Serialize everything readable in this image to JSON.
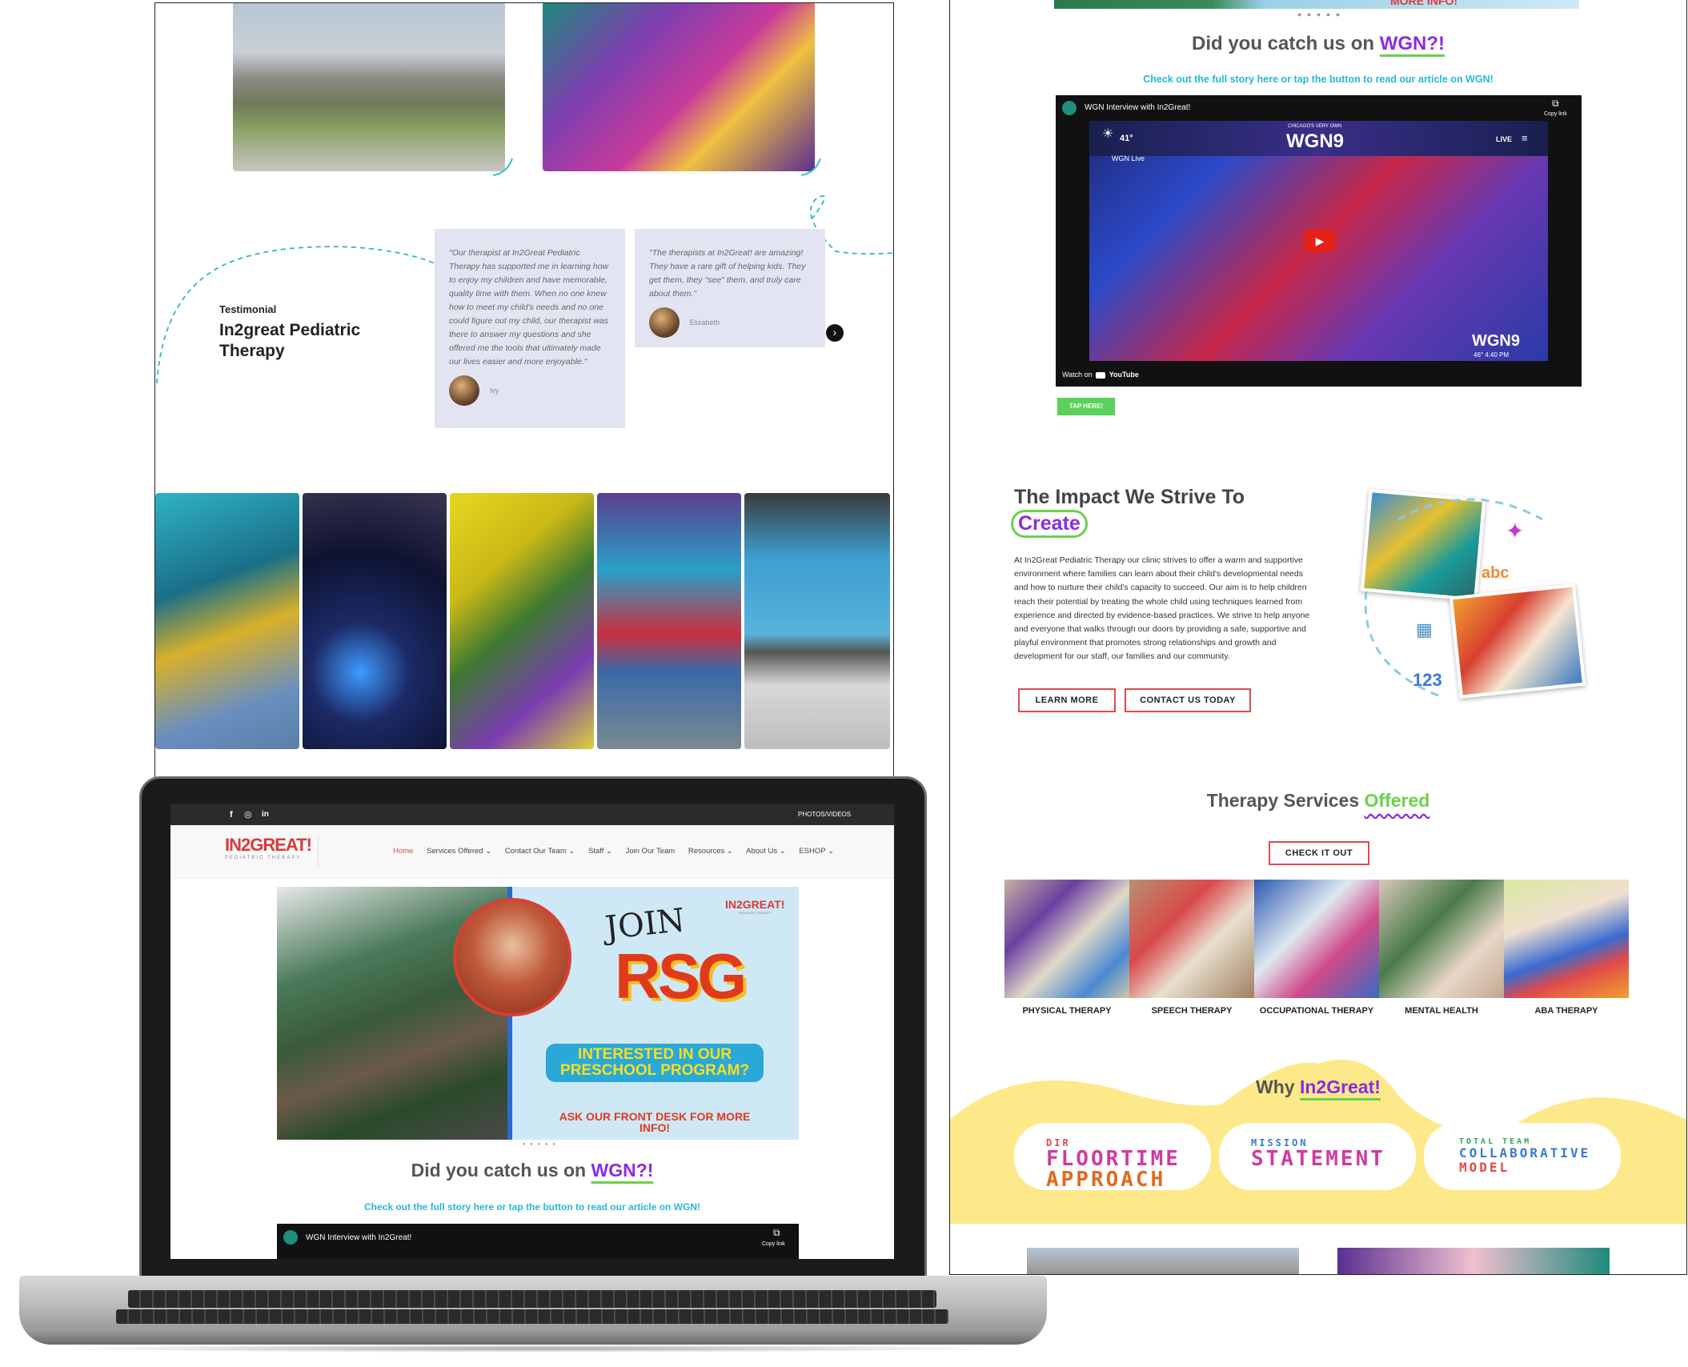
{
  "left_panel": {
    "testimonial_label": "Testimonial",
    "testimonial_title": "In2great Pediatric Therapy",
    "testimonials": [
      {
        "text": "\"Our therapist at In2Great Pediatric Therapy has supported me in learning how to enjoy my children and have memorable, quality time with them. When no one knew how to meet my child's needs and no one could figure out my child, our therapist was there to answer my questions and she offered me the tools that ultimately made our lives easier and more enjoyable.\"",
        "author": "Ivy"
      },
      {
        "text": "\"The therapists at In2Great! are amazing! They have a rare gift of helping kids. They get them, they \"see\" them, and truly care about them.\"",
        "author": "Elizabeth"
      }
    ]
  },
  "laptop": {
    "social_icons": [
      "facebook-icon",
      "instagram-icon",
      "linkedin-icon"
    ],
    "top_right_link": "PHOTOS/VIDEOS",
    "logo_text": "IN2GREAT!",
    "logo_subtext": "PEDIATRIC THERAPY",
    "nav": [
      "Home",
      "Services Offered",
      "Contact Our Team",
      "Staff",
      "Join Our Team",
      "Resources",
      "About Us",
      "ESHOP"
    ],
    "nav_dropdowns": [
      false,
      true,
      true,
      true,
      false,
      true,
      true,
      true
    ],
    "hero": {
      "join": "JOIN",
      "rsg": "RSG",
      "interested": "INTERESTED IN OUR PRESCHOOL PROGRAM?",
      "ask": "ASK OUR FRONT DESK FOR MORE INFO!",
      "logo_text": "IN2GREAT!",
      "logo_subtext": "PEDIATRIC THERAPY"
    },
    "wgn_heading_prefix": "Did you catch us on ",
    "wgn_heading_highlight": "WGN?!",
    "wgn_subtext": "Check out the full story here or tap the button to read our article on WGN!",
    "video_title": "WGN Interview with In2Great!",
    "copy_link": "Copy link"
  },
  "right_panel": {
    "top_banner_text": "MORE INFO!",
    "wgn_heading_prefix": "Did you catch us on ",
    "wgn_heading_highlight": "WGN?!",
    "wgn_subtext": "Check out the full story here or tap the button to read our article on WGN!",
    "video": {
      "title": "WGN Interview with In2Great!",
      "copy_link": "Copy link",
      "temperature": "41°",
      "channel_small": "CHICAGO'S VERY OWN",
      "channel": "WGN9",
      "live": "LIVE",
      "ticker": "WGN Live",
      "corner_logo": "WGN9",
      "corner_info": "46° 4:40 PM",
      "watch_on": "Watch on",
      "youtube": "YouTube"
    },
    "tap_here": "TAP HERE!",
    "impact": {
      "title_line1": "The Impact We Strive To",
      "title_highlight": "Create",
      "body": "At In2Great Pediatric Therapy our clinic strives to offer a warm and supportive environment where families can learn about their child's developmental needs and how to nurture their child's capacity to succeed. Our aim is to help children reach their potential by treating the whole child using techniques learned from experience and directed by evidence-based practices. We strive to help anyone and everyone that walks through our doors by providing a safe, supportive and playful environment that promotes strong relationships and growth and development for our staff, our families and our community.",
      "learn_more": "LEARN MORE",
      "contact": "CONTACT US TODAY",
      "abc": "abc",
      "num": "123"
    },
    "services": {
      "title_prefix": "Therapy Services ",
      "title_highlight": "Offered",
      "check_it_out": "CHECK IT OUT",
      "items": [
        "PHYSICAL THERAPY",
        "SPEECH THERAPY",
        "OCCUPATIONAL THERAPY",
        "MENTAL HEALTH",
        "ABA THERAPY"
      ]
    },
    "why": {
      "title_prefix": "Why ",
      "title_highlight": "In2Great!",
      "pills": [
        {
          "small": "DIR",
          "big1": "FLOORTIME",
          "big2": "APPROACH"
        },
        {
          "small": "MISSION",
          "big1": "STATEMENT",
          "big2": ""
        },
        {
          "small": "TOTAL TEAM",
          "big1": "COLLABORATIVE",
          "big2": "MODEL"
        }
      ]
    }
  },
  "colors": {
    "accent_purple": "#8a2be2",
    "accent_green": "#6bd04a",
    "accent_red": "#e04a4a",
    "teal_text": "#2ab5d8",
    "card_bg": "#e3e4f2",
    "yellow_band": "#fde98a"
  }
}
